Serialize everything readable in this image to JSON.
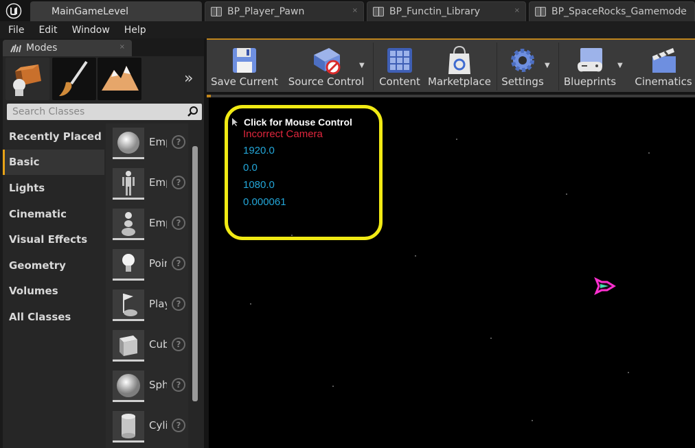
{
  "tabs": [
    {
      "label": "MainGameLevel",
      "active": true
    },
    {
      "label": "BP_Player_Pawn",
      "close": "×"
    },
    {
      "label": "BP_Functin_Library",
      "close": "×"
    },
    {
      "label": "BP_SpaceRocks_Gamemode",
      "close": "×"
    }
  ],
  "menu": [
    "File",
    "Edit",
    "Window",
    "Help"
  ],
  "modes": {
    "title": "Modes",
    "close": "×",
    "more": "»",
    "search_placeholder": "Search Classes",
    "categories": [
      "Recently Placed",
      "Basic",
      "Lights",
      "Cinematic",
      "Visual Effects",
      "Geometry",
      "Volumes",
      "All Classes"
    ],
    "active_category": "Basic",
    "items": [
      {
        "name": "Empty Actor",
        "icon": "sphere-icon"
      },
      {
        "name": "Empty Character",
        "icon": "mannequin-icon"
      },
      {
        "name": "Empty Pawn",
        "icon": "pawn-icon"
      },
      {
        "name": "Point Light",
        "icon": "light-bulb-icon"
      },
      {
        "name": "Player Start",
        "icon": "player-start-icon"
      },
      {
        "name": "Cube",
        "icon": "cube-icon"
      },
      {
        "name": "Sphere",
        "icon": "sphere-icon"
      },
      {
        "name": "Cylinder",
        "icon": "cylinder-icon"
      }
    ],
    "help": "?"
  },
  "toolbar": {
    "save": "Save Current",
    "source_control": "Source Control",
    "content": "Content",
    "marketplace": "Marketplace",
    "settings": "Settings",
    "blueprints": "Blueprints",
    "cinematics": "Cinematics",
    "dropdown_arrow": "▼"
  },
  "viewport": {
    "mouse_hint": "Click for Mouse Control",
    "warning": "Incorrect Camera",
    "values": [
      "1920.0",
      "0.0",
      "1080.0",
      "0.000061"
    ],
    "colors": {
      "highlight": "#f1ea14",
      "warning": "#e0263d",
      "value": "#23a6d8",
      "ship": "#ff2fd0"
    }
  }
}
